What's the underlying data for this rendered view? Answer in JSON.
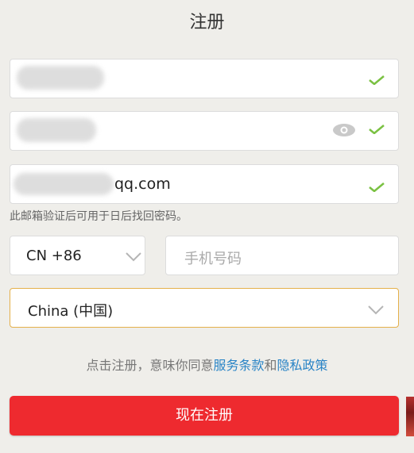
{
  "header": {
    "title": "注册"
  },
  "fields": {
    "email_suffix": "qq.com",
    "email_hint": "此邮箱验证后可用于日后找回密码。",
    "country_code": "CN +86",
    "phone_placeholder": "手机号码",
    "region": "China (中国)"
  },
  "agreement": {
    "prefix": "点击注册，意味你同意",
    "terms_link": "服务条款",
    "and": "和",
    "privacy_link": "隐私政策"
  },
  "submit_label": "现在注册",
  "colors": {
    "accent_red": "#ee2a2f",
    "link_blue": "#2a84c6",
    "check_green": "#7ac142",
    "focus_border": "#e4b04a"
  },
  "icons": {
    "valid": "check-icon",
    "show_password": "eye-icon",
    "dropdown": "chevron-down-icon"
  }
}
